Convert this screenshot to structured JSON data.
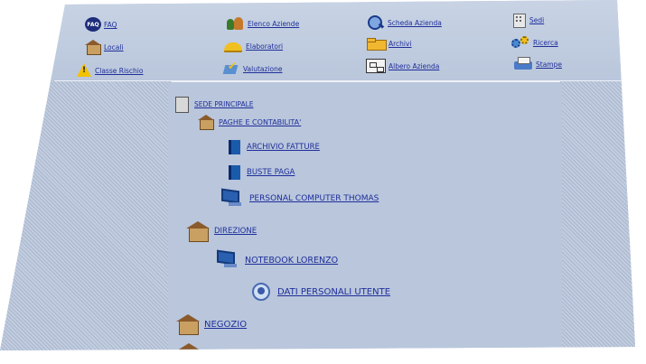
{
  "menu": {
    "faq": "FAQ",
    "locali": "Locali",
    "classe_rischio": "Classe Rischio",
    "elenco_aziende": "Elenco Aziende",
    "elaboratori": "Elaboratori",
    "valutazione": "Valutazione",
    "scheda_azienda": "Scheda Azienda",
    "archivi": "Archivi",
    "albero_azienda": "Albero Azienda",
    "sedi": "Sedi",
    "ricerca": "Ricerca",
    "stampe": "Stampe"
  },
  "tree": {
    "sede": "SEDE PRINCIPALE",
    "paghe": "PAGHE E CONTABILITA'",
    "archivio_fatture": "ARCHIVIO FATTURE",
    "buste_paga": "BUSTE PAGA",
    "pc_thomas": "PERSONAL COMPUTER THOMAS",
    "direzione": "DIREZIONE",
    "notebook_lorenzo": "NOTEBOOK LORENZO",
    "dati_personali": "DATI PERSONALI UTENTE",
    "negozio": "NEGOZIO"
  },
  "icon_names": [
    "faq-icon",
    "house-icon",
    "warning-icon",
    "people-icon",
    "hard-hat-icon",
    "checklist-icon",
    "magnifier-icon",
    "folder-icon",
    "tree-icon",
    "building-icon",
    "gears-icon",
    "printer-icon",
    "book-icon",
    "computer-icon",
    "user-data-icon"
  ],
  "colors": {
    "panel": "#b6c3d8",
    "link": "#1f2f9a"
  }
}
